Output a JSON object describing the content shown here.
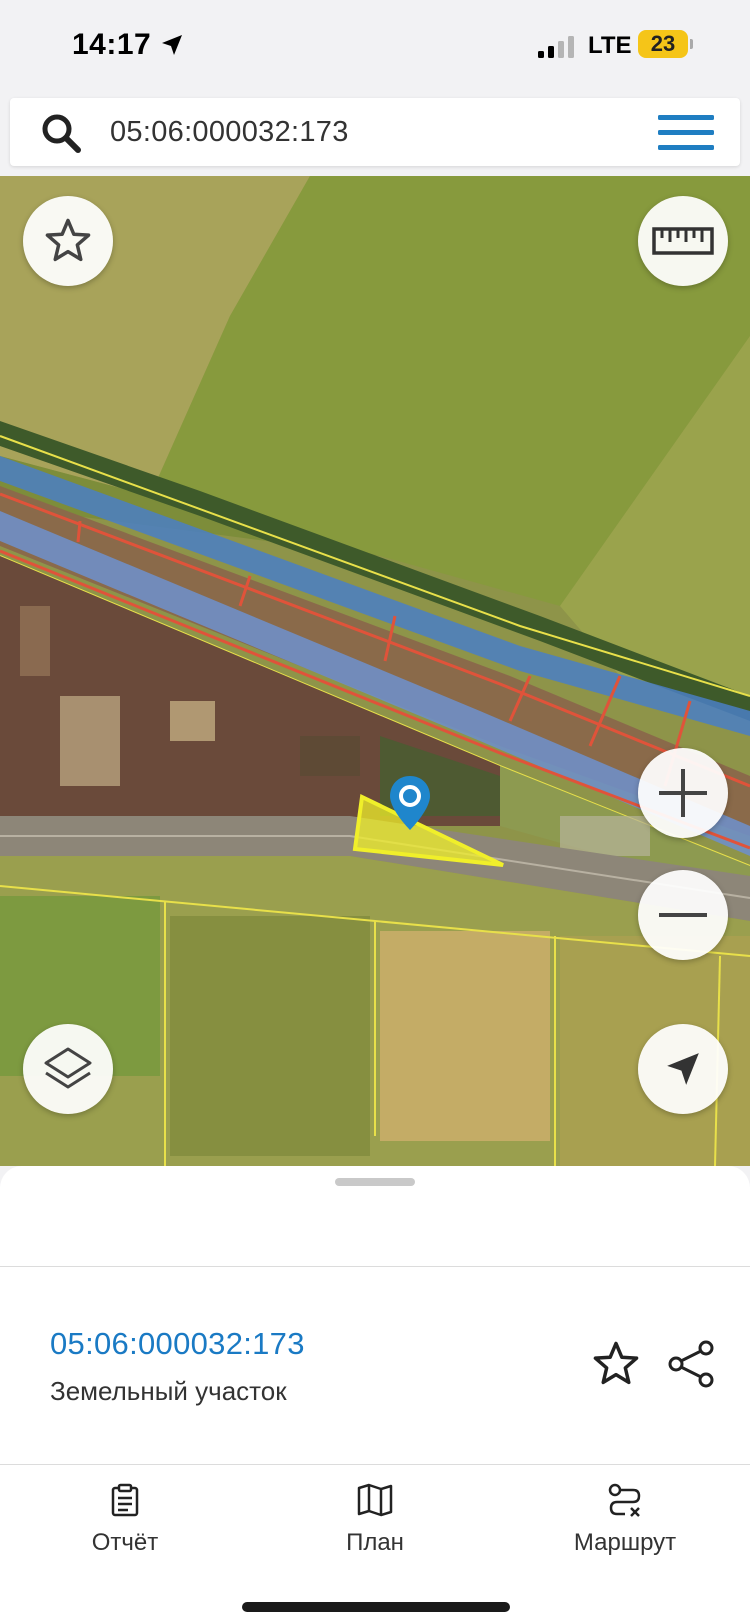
{
  "status_bar": {
    "time": "14:17",
    "network": "LTE",
    "battery": "23"
  },
  "search": {
    "query": "05:06:000032:173"
  },
  "map": {
    "buttons": [
      "star-icon",
      "ruler-icon",
      "zoom-in-icon",
      "zoom-out-icon",
      "layers-icon",
      "locate-icon"
    ],
    "parcel_color": "#f0ef2a",
    "pin_color": "#1f86cc"
  },
  "card": {
    "parcel_id": "05:06:000032:173",
    "parcel_type": "Земельный участок"
  },
  "bottom_nav": {
    "report": "Отчёт",
    "plan": "План",
    "route": "Маршрут"
  },
  "colors": {
    "accent": "#1a7ac4",
    "menu": "#1f7ec2"
  }
}
